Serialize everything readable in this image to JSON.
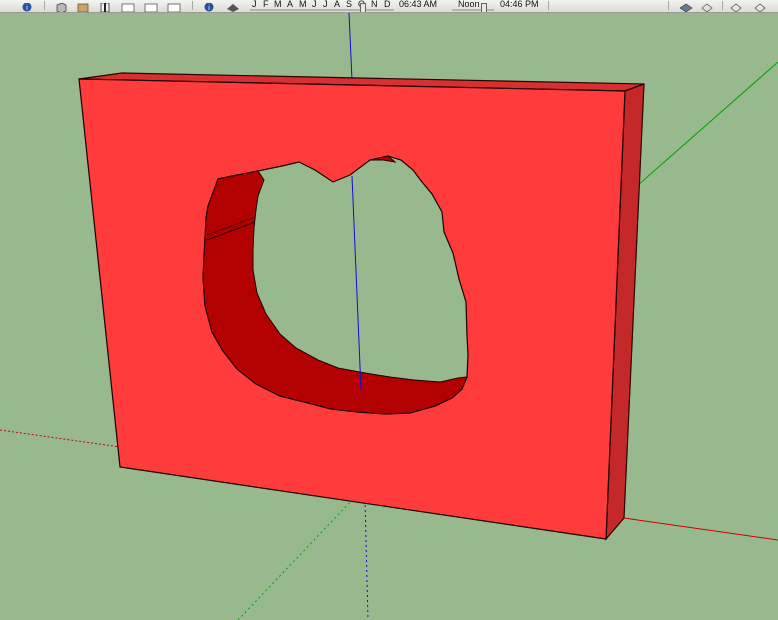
{
  "toolbar": {
    "months": [
      "J",
      "F",
      "M",
      "A",
      "M",
      "J",
      "J",
      "A",
      "S",
      "O",
      "N",
      "D"
    ],
    "sunrise_time": "06:43 AM",
    "noon_label": "Noon",
    "sunset_time": "04:46 PM"
  },
  "colors": {
    "background": "#98b98e",
    "face": "#ff3b3b",
    "hole_interior": "#b30000",
    "side_face": "#c42828",
    "axis_red": "#cc0000",
    "axis_green": "#00a000",
    "axis_blue": "#1010d0"
  },
  "icons": [
    "info-icon",
    "cube-icon",
    "box-icon",
    "section-plane-icon",
    "rect-view-icon",
    "rect-view-icon",
    "rect-view-icon",
    "shadows-icon",
    "fog-icon",
    "layers-icon",
    "styles-icon"
  ]
}
